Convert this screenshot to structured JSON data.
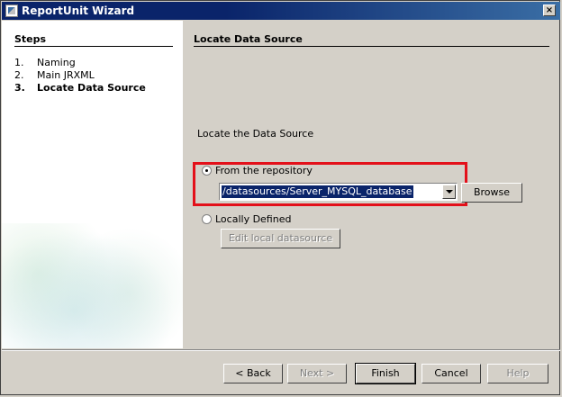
{
  "window": {
    "title": "ReportUnit Wizard",
    "close_glyph": "×"
  },
  "steps": {
    "title": "Steps",
    "items": [
      {
        "num": "1.",
        "label": "Naming"
      },
      {
        "num": "2.",
        "label": "Main JRXML"
      },
      {
        "num": "3.",
        "label": "Locate Data Source"
      }
    ]
  },
  "content": {
    "title": "Locate Data Source",
    "locate_label": "Locate the Data Source",
    "from_repository_label": "From the repository",
    "repository_value": "/datasources/Server_MYSQL_database",
    "browse_label": "Browse",
    "locally_defined_label": "Locally Defined",
    "edit_local_label": "Edit local datasource"
  },
  "footer": {
    "back_label": "< Back",
    "next_label": "Next >",
    "finish_label": "Finish",
    "cancel_label": "Cancel",
    "help_label": "Help"
  },
  "colors": {
    "highlight": "#e3101a",
    "title_bar": "#0a246a"
  }
}
